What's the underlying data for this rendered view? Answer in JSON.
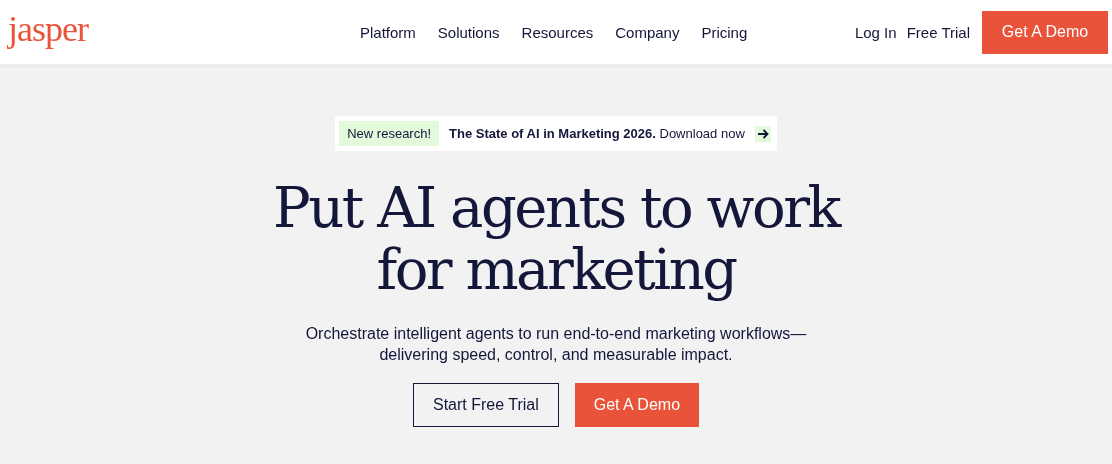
{
  "header": {
    "logo": "jasper",
    "nav": [
      "Platform",
      "Solutions",
      "Resources",
      "Company",
      "Pricing"
    ],
    "login": "Log In",
    "free_trial": "Free Trial",
    "demo_button": "Get A Demo"
  },
  "announcement": {
    "badge": "New research!",
    "link": "**The State of AI in Marketing 2026.** Download now"
  },
  "hero": {
    "headline": "Put AI agents to work for marketing",
    "subtitle": "Orchestrate intelligent agents to run end-to-end marketing workflows—delivering speed, control, and measurable impact.",
    "buttons": [
      {
        "label": "Start Free Trial",
        "kind": "outline"
      },
      {
        "label": "Get A Demo",
        "kind": "primary"
      }
    ]
  }
}
